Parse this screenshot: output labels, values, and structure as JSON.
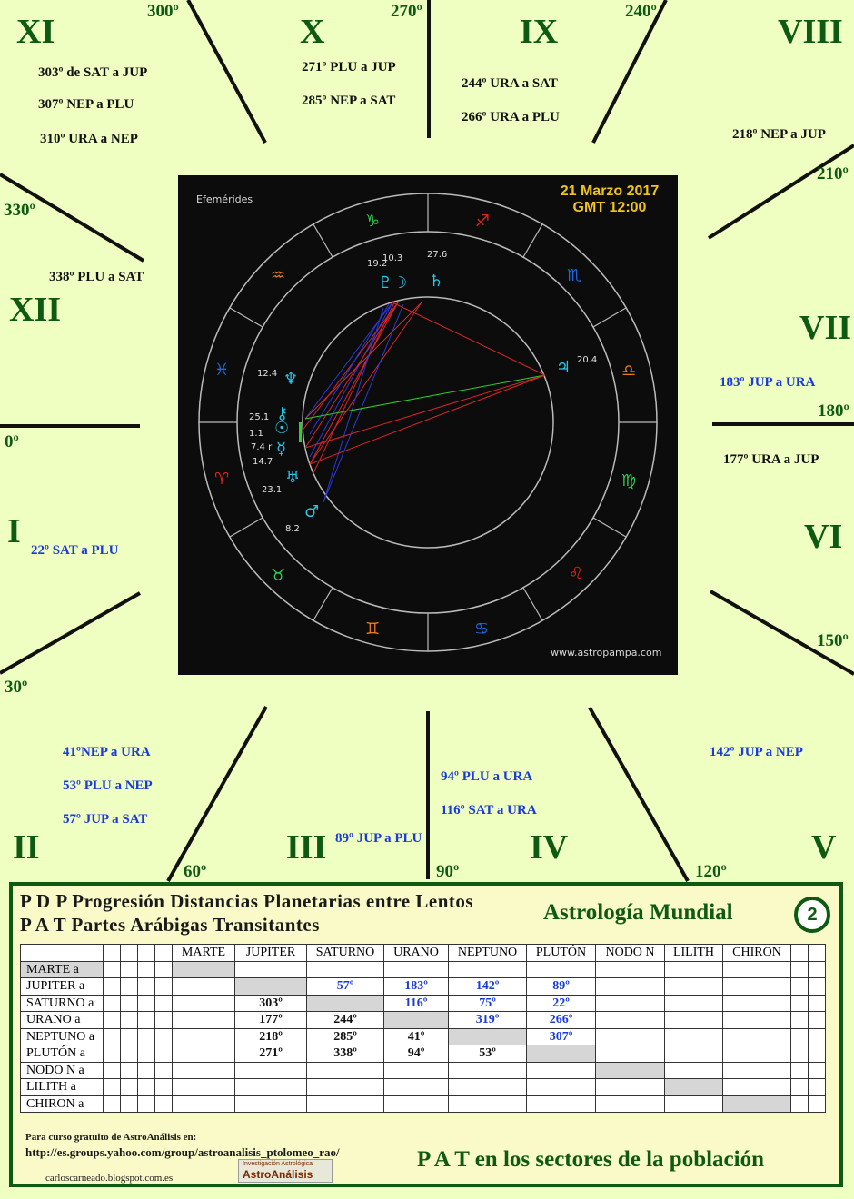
{
  "houses": {
    "XI": "XI",
    "X": "X",
    "IX": "IX",
    "VIII": "VIII",
    "XII": "XII",
    "VII": "VII",
    "I": "I",
    "VI": "VI",
    "II": "II",
    "III": "III",
    "IV": "IV",
    "V": "V"
  },
  "degrees": {
    "d300": "300º",
    "d270": "270º",
    "d240": "240º",
    "d210": "210º",
    "d330": "330º",
    "d180": "180º",
    "d0": "0º",
    "d150": "150º",
    "d30": "30º",
    "d60": "60º",
    "d90": "90º",
    "d120": "120º"
  },
  "notes": {
    "n1": "303º de SAT a JUP",
    "n2": "307º NEP a PLU",
    "n3": "310º URA a NEP",
    "n4": "271º PLU a JUP",
    "n5": "285º NEP a SAT",
    "n6": "244º URA a SAT",
    "n7": "266º URA a PLU",
    "n8": "218º NEP a JUP",
    "n9": "338º PLU a SAT",
    "n10": "183º JUP a URA",
    "n11": "177º URA a JUP",
    "n12": "22º SAT a PLU",
    "n13": "41ºNEP a URA",
    "n14": "53º PLU a NEP",
    "n15": "57º  JUP a SAT",
    "n16": "89º JUP a PLU",
    "n17": "94º PLU a URA",
    "n18": "116º SAT a URA",
    "n19": "142º JUP a NEP"
  },
  "chart": {
    "label": "Efemérides",
    "date": "21 Marzo 2017",
    "time": "GMT 12:00",
    "site": "www.astropampa.com",
    "signs": {
      "capricorn": "♑",
      "sagittarius": "♐",
      "scorpio": "♏",
      "libra": "♎",
      "virgo": "♍",
      "leo": "♌",
      "cancer": "♋",
      "gemini": "♊",
      "taurus": "♉",
      "aries": "♈",
      "pisces": "♓",
      "aquarius": "♒"
    },
    "signColors": {
      "earth": "#2bd04a",
      "fire": "#e0241e",
      "air": "#e87b1e",
      "water": "#1a6be0"
    },
    "planets": {
      "pluto": "♇",
      "moon": "☽",
      "saturn": "♄",
      "jupiter": "♃",
      "neptune": "♆",
      "chiron": "⚷",
      "sun": "☉",
      "mercury": "☿",
      "uranus": "♅",
      "mars": "♂"
    },
    "planetColor": "#22c8e8",
    "positions": {
      "p1": "19.2",
      "p2": "10.3",
      "p3": "27.6",
      "p4": "20.4",
      "p5": "12.4",
      "p6": "25.1",
      "p7": "1.1",
      "p8": "7.4 r",
      "p9": "14.7",
      "p10": "23.1",
      "p11": "8.2"
    },
    "aspectColors": {
      "red": "#d8262a",
      "blue": "#2b3ad8",
      "green": "#2ad22a"
    }
  },
  "panel": {
    "title1": "P D P  Progresión Distancias Planetarias entre Lentos",
    "title2": "P A T  Partes Arábigas Transitantes",
    "brand": "Astrología  Mundial",
    "number": "2",
    "columns": [
      "MARTE",
      "JUPITER",
      "SATURNO",
      "URANO",
      "NEPTUNO",
      "PLUTÓN",
      "NODO N",
      "LILITH",
      "CHIRON"
    ],
    "rows": [
      {
        "label": "MARTE a",
        "cells": [
          "",
          "",
          "",
          "",
          "",
          "",
          "",
          "",
          ""
        ]
      },
      {
        "label": "JUPITER a",
        "cells": [
          "",
          "",
          "57º",
          "183º",
          "142º",
          "89º",
          "",
          "",
          ""
        ]
      },
      {
        "label": "SATURNO a",
        "cells": [
          "",
          "303º",
          "",
          "116º",
          "75º",
          "22º",
          "",
          "",
          ""
        ]
      },
      {
        "label": "URANO a",
        "cells": [
          "",
          "177º",
          "244º",
          "",
          "319º",
          "266º",
          "",
          "",
          ""
        ]
      },
      {
        "label": "NEPTUNO a",
        "cells": [
          "",
          "218º",
          "285º",
          "41º",
          "",
          "307º",
          "",
          "",
          ""
        ]
      },
      {
        "label": "PLUTÓN a",
        "cells": [
          "",
          "271º",
          "338º",
          "94º",
          "53º",
          "",
          "",
          "",
          ""
        ]
      },
      {
        "label": "NODO N a",
        "cells": [
          "",
          "",
          "",
          "",
          "",
          "",
          "",
          "",
          ""
        ]
      },
      {
        "label": "LILITH a",
        "cells": [
          "",
          "",
          "",
          "",
          "",
          "",
          "",
          "",
          ""
        ]
      },
      {
        "label": "CHIRON a",
        "cells": [
          "",
          "",
          "",
          "",
          "",
          "",
          "",
          "",
          ""
        ]
      }
    ],
    "footer1": "Para curso gratuito de AstroAnálisis en:",
    "footer2": "http://es.groups.yahoo.com/group/astroanalisis_ptolomeo_rao/",
    "footer3": "carloscarneado.blogspot.com.es",
    "logo1": "Investigación Astrológica",
    "logo2": "AstroAnálisis",
    "pat": "P A T  en los sectores de la población"
  }
}
